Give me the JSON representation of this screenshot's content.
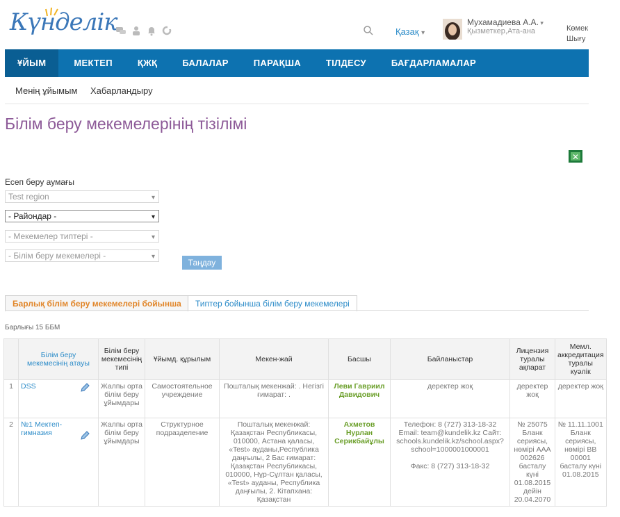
{
  "brand": {
    "logo": "Күнделік"
  },
  "header": {
    "language": "Қазақ",
    "user_name": "Мухамадиева А.А.",
    "user_role": "Қызметкер,Ата-ана",
    "help": "Көмек",
    "logout": "Шығу"
  },
  "nav": {
    "items": [
      "ҰЙЫМ",
      "МЕКТЕП",
      "ҚЖҚ",
      "БАЛАЛАР",
      "ПАРАҚША",
      "ТІЛДЕСУ",
      "БАҒДАРЛАМАЛАР"
    ]
  },
  "subnav": {
    "items": [
      "Менің ұйымым",
      "Хабарландыру"
    ]
  },
  "page": {
    "title": "Білім беру мекемелерінің тізілімі"
  },
  "filters": {
    "label": "Есеп беру аумағы",
    "region": "Test region",
    "district": "- Райондар -",
    "types": "- Мекемелер типтері -",
    "schools": "- Білім беру мекемелері -",
    "choose": "Таңдау"
  },
  "tabs": [
    "Барлық білім беру мекемелері бойынша",
    "Типтер бойынша білім беру мекемелері"
  ],
  "total": "Барлығы 15 ББМ",
  "table": {
    "headers": [
      "Білім беру мекемесінің атауы",
      "Білім беру мекемесінің типі",
      "Ұйымд. құрылым",
      "Мекен-жай",
      "Басшы",
      "Байланыстар",
      "Лицензия туралы ақпарат",
      "Мемл. аккредитация туралы куәлік"
    ],
    "rows": [
      {
        "num": "1",
        "name": "DSS",
        "type": "Жалпы орта білім беру ұйымдары",
        "structure": "Самостоятельное учреждение",
        "address": "Пошталық мекенжай: . Негізгі ғимарат: .",
        "head": "Леви Гавриил Давидович",
        "contacts": "деректер жоқ",
        "license": "деректер жоқ",
        "accreditation": "деректер жоқ"
      },
      {
        "num": "2",
        "name": "№1 Мектеп-гимназия",
        "type": "Жалпы орта білім беру ұйымдары",
        "structure": "Структурное подразделение",
        "address": "Пошталық мекенжай: Қазақстан Республикасы, 010000, Астана қаласы, «Test» ауданы,Республика даңғылы, 2 Бас ғимарат: Қазақстан Республикасы, 010000, Нұр-Сұлтан қаласы, «Test» ауданы, Республика даңғылы, 2. Кітапхана: Қазақстан",
        "head": "Ахметов Нурлан Серикбайұлы",
        "contacts": "Телефон: 8 (727) 313-18-32 Email: team@kundelik.kz Сайт: schools.kundelik.kz/school.aspx?school=1000001000001",
        "fax": "Факс: 8 (727) 313-18-32",
        "license": "№ 25075 Бланк сериясы, нөмірі ААА 002626 басталу күні 01.08.2015 дейін 20.04.2070",
        "accreditation": "№ 11.11.1001 Бланк сериясы, нөмірі ВВ 00001 басталу күні 01.08.2015"
      }
    ]
  }
}
